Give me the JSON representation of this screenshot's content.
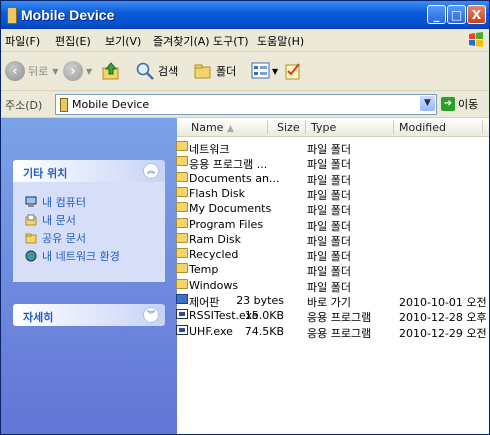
{
  "window": {
    "title": "Mobile Device",
    "controls": {
      "minimize": "_",
      "maximize": "□",
      "close": "X"
    }
  },
  "menu": [
    "파일(F)",
    "편집(E)",
    "보기(V)",
    "즐겨찾기(A)",
    "도구(T)",
    "도움말(H)"
  ],
  "toolbar": {
    "back": "뒤로",
    "search": "검색",
    "folders": "폴더"
  },
  "address": {
    "label": "주소(D)",
    "value": "Mobile Device",
    "go": "이동"
  },
  "taskpane": {
    "other_places": {
      "title": "기타 위치",
      "items": [
        {
          "label": "내 컴퓨터",
          "icon": "my-computer-icon"
        },
        {
          "label": "내 문서",
          "icon": "my-documents-icon"
        },
        {
          "label": "공유 문서",
          "icon": "shared-documents-icon"
        },
        {
          "label": "내 네트워크 환경",
          "icon": "network-icon"
        }
      ]
    },
    "details": {
      "title": "자세히"
    }
  },
  "columns": {
    "name": "Name",
    "size": "Size",
    "type": "Type",
    "modified": "Modified"
  },
  "files": [
    {
      "name": "네트워크",
      "size": "",
      "type": "파일 폴더",
      "modified": "",
      "icon": "folder"
    },
    {
      "name": "응용 프로그램 ...",
      "size": "",
      "type": "파일 폴더",
      "modified": "",
      "icon": "folder"
    },
    {
      "name": "Documents an...",
      "size": "",
      "type": "파일 폴더",
      "modified": "",
      "icon": "folder"
    },
    {
      "name": "Flash Disk",
      "size": "",
      "type": "파일 폴더",
      "modified": "",
      "icon": "folder"
    },
    {
      "name": "My Documents",
      "size": "",
      "type": "파일 폴더",
      "modified": "",
      "icon": "folder"
    },
    {
      "name": "Program Files",
      "size": "",
      "type": "파일 폴더",
      "modified": "",
      "icon": "folder"
    },
    {
      "name": "Ram Disk",
      "size": "",
      "type": "파일 폴더",
      "modified": "",
      "icon": "folder"
    },
    {
      "name": "Recycled",
      "size": "",
      "type": "파일 폴더",
      "modified": "",
      "icon": "folder"
    },
    {
      "name": "Temp",
      "size": "",
      "type": "파일 폴더",
      "modified": "",
      "icon": "folder"
    },
    {
      "name": "Windows",
      "size": "",
      "type": "파일 폴더",
      "modified": "",
      "icon": "folder"
    },
    {
      "name": "제어판",
      "size": "23 bytes",
      "type": "바로 가기",
      "modified": "2010-10-01 오전 ...",
      "icon": "shortcut"
    },
    {
      "name": "RSSITest.exe",
      "size": "15.0KB",
      "type": "응용 프로그램",
      "modified": "2010-12-28 오후 ...",
      "icon": "exe"
    },
    {
      "name": "UHF.exe",
      "size": "74.5KB",
      "type": "응용 프로그램",
      "modified": "2010-12-29 오전 ...",
      "icon": "exe"
    }
  ],
  "colors": {
    "titlebar": "#0a58d8",
    "taskpane": "#6f8fdf",
    "link": "#215dc6",
    "folder": "#f2d56b"
  }
}
